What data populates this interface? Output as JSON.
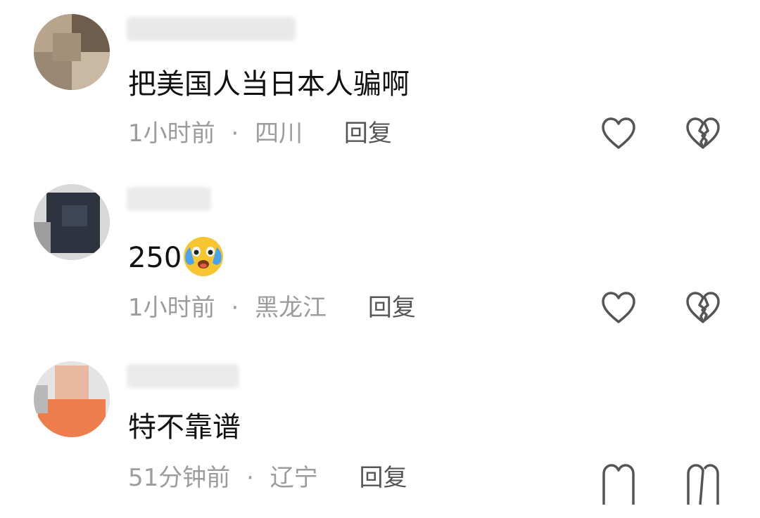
{
  "comments": [
    {
      "text": "把美国人当日本人骗啊",
      "time": "1小时前",
      "separator": "·",
      "location": "四川",
      "reply_label": "回复"
    },
    {
      "text": "250",
      "emoji": "crying-face-emoji",
      "time": "1小时前",
      "separator": "·",
      "location": "黑龙江",
      "reply_label": "回复"
    },
    {
      "text": "特不靠谱",
      "time": "51分钟前",
      "separator": "·",
      "location": "辽宁",
      "reply_label": "回复"
    }
  ],
  "icons": {
    "like": "heart-icon",
    "dislike": "broken-heart-icon"
  },
  "colors": {
    "text": "#111111",
    "meta": "#9c9c9c",
    "reply": "#555555",
    "icon": "#555555"
  }
}
